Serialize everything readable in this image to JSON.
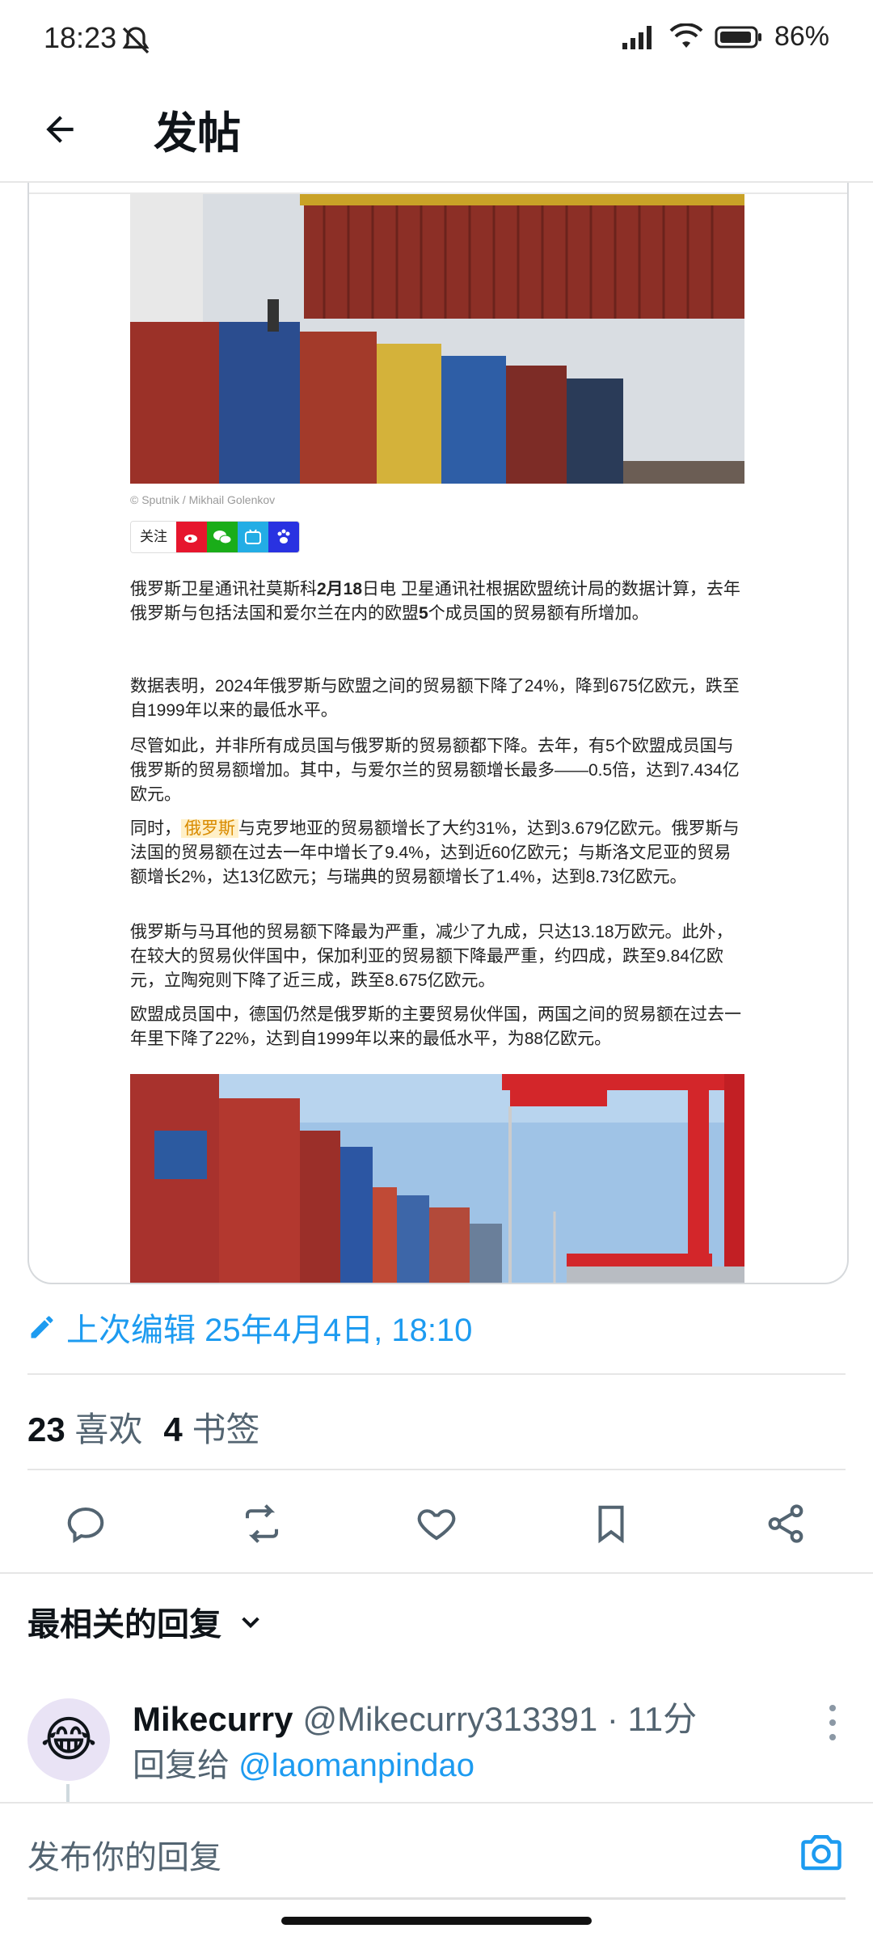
{
  "status_bar": {
    "time": "18:23",
    "battery": "86%"
  },
  "header": {
    "title": "发帖"
  },
  "article": {
    "photo_credit": "© Sputnik / Mikhail Golenkov",
    "share_follow": "关注",
    "p1_a": "俄罗斯卫星通讯社莫斯科",
    "p1_b": "2月18",
    "p1_c": "日电 卫星通讯社根据欧盟统计局的数据计算，去年俄罗斯与包括法国和爱尔兰在内的欧盟",
    "p1_d": "5",
    "p1_e": "个成员国的贸易额有所增加。",
    "p2": "数据表明，2024年俄罗斯与欧盟之间的贸易额下降了24%，降到675亿欧元，跌至自1999年以来的最低水平。",
    "p3": "尽管如此，并非所有成员国与俄罗斯的贸易额都下降。去年，有5个欧盟成员国与俄罗斯的贸易额增加。其中，与爱尔兰的贸易额增长最多——0.5倍，达到7.434亿欧元。",
    "p4_a": "同时，",
    "p4_hl": "俄罗斯",
    "p4_b": "与克罗地亚的贸易额增长了大约31%，达到3.679亿欧元。俄罗斯与法国的贸易额在过去一年中增长了9.4%，达到近60亿欧元；与斯洛文尼亚的贸易额增长2%，达13亿欧元；与瑞典的贸易额增长了1.4%，达到8.73亿欧元。",
    "p5": "俄罗斯与马耳他的贸易额下降最为严重，减少了九成，只达13.18万欧元。此外，在较大的贸易伙伴国中，保加利亚的贸易额下降最严重，约四成，跌至9.84亿欧元，立陶宛则下降了近三成，跌至8.675亿欧元。",
    "p6": "欧盟成员国中，德国仍然是俄罗斯的主要贸易伙伴国，两国之间的贸易额在过去一年里下降了22%，达到自1999年以来的最低水平，为88亿欧元。"
  },
  "meta": {
    "edited": "上次编辑 25年4月4日, 18:10",
    "likes_count": "23",
    "likes_label": "喜欢",
    "bookmarks_count": "4",
    "bookmarks_label": "书签"
  },
  "actions": [
    "reply-icon",
    "repost-icon",
    "like-icon",
    "bookmark-icon",
    "share-icon"
  ],
  "replies": {
    "sort_label": "最相关的回复",
    "items": [
      {
        "name": "Mikecurry",
        "handle": "@Mikecurry313391 · 11分",
        "reply_to_prefix": "回复给 ",
        "reply_to_handle": "@laomanpindao",
        "avatar_emoji": "😂"
      }
    ]
  },
  "composer": {
    "placeholder": "发布你的回复"
  },
  "colors": {
    "accent": "#1d9bf0",
    "text": "#0f1419",
    "muted": "#536471"
  }
}
